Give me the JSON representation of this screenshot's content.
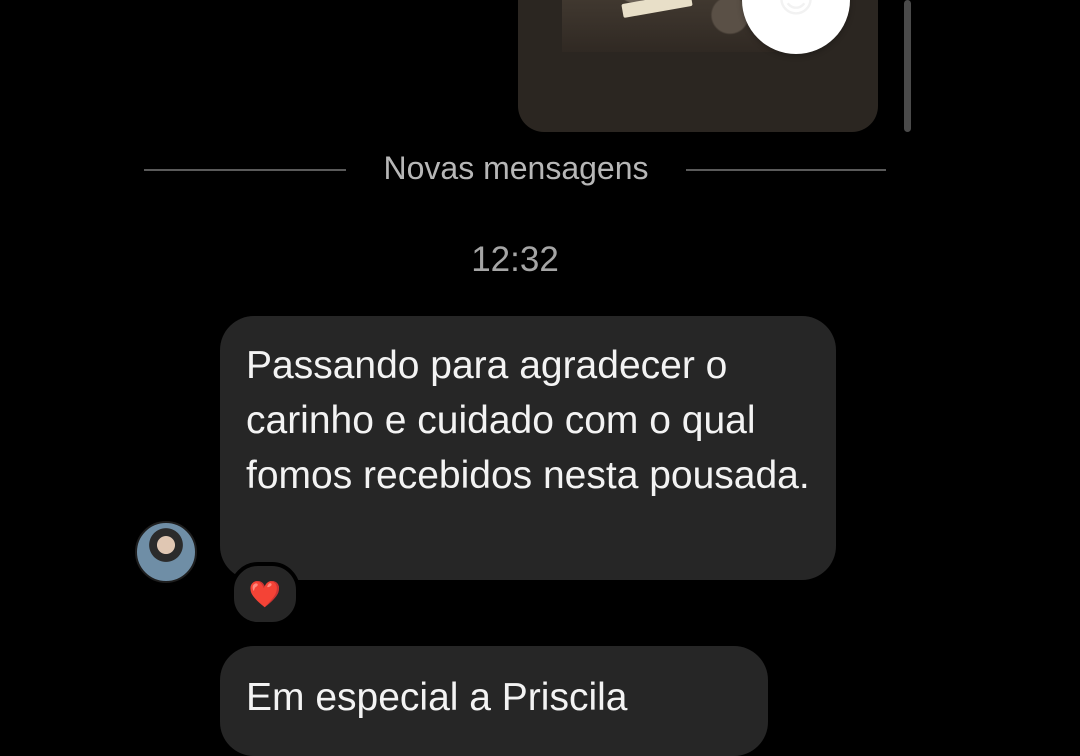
{
  "story": {
    "reaction_emoji": "😍"
  },
  "divider": {
    "label": "Novas mensagens"
  },
  "timestamp": "12:32",
  "messages": [
    {
      "text": "Passando para agradecer o carinho e cuidado com o qual fomos recebidos nesta pousada.",
      "reaction": "❤️"
    },
    {
      "text": "Em especial a Priscila"
    }
  ],
  "colors": {
    "background": "#000000",
    "bubble": "#262626",
    "story_card": "#2b2621",
    "accent_heart": "#ff2d55"
  }
}
